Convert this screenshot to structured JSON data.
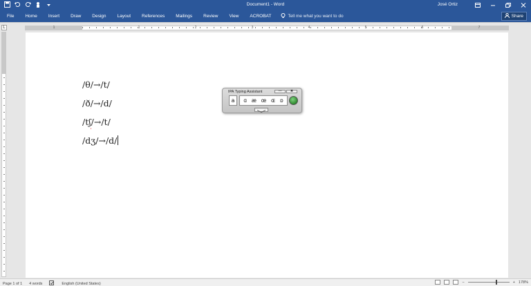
{
  "window": {
    "doc_title": "Document1 - Word",
    "user": "José Ortiz"
  },
  "ribbon": {
    "tabs": [
      "File",
      "Home",
      "Insert",
      "Draw",
      "Design",
      "Layout",
      "References",
      "Mailings",
      "Review",
      "View",
      "ACROBAT"
    ],
    "tellme": "Tell me what you want to do",
    "share": "Share"
  },
  "ruler": {
    "numbers": [
      "1",
      "1",
      "2",
      "3",
      "4",
      "5",
      "6",
      "7"
    ]
  },
  "document": {
    "lines": [
      {
        "text": "/θ/→/t/"
      },
      {
        "text": "/ð/→/d/"
      },
      {
        "pre": "/t",
        "squig": "ʃ",
        "post": "/→/t/"
      },
      {
        "text": "/dʒ/→/d/"
      }
    ]
  },
  "ipa_assistant": {
    "title": "IPA Typing Assistant",
    "minimize": "—",
    "close": "✖",
    "key": "a",
    "symbols": [
      "ɑ",
      "æ",
      "œ",
      "ɶ",
      "ɒ"
    ]
  },
  "status": {
    "page": "Page 1 of 1",
    "words": "4 words",
    "language": "English (United States)",
    "zoom": "178%",
    "zoom_minus": "−",
    "zoom_plus": "+"
  },
  "colors": {
    "ribbon": "#2b579a",
    "spelling_error": "#dd0000",
    "ipa_go_button": "#2f8a2f"
  }
}
